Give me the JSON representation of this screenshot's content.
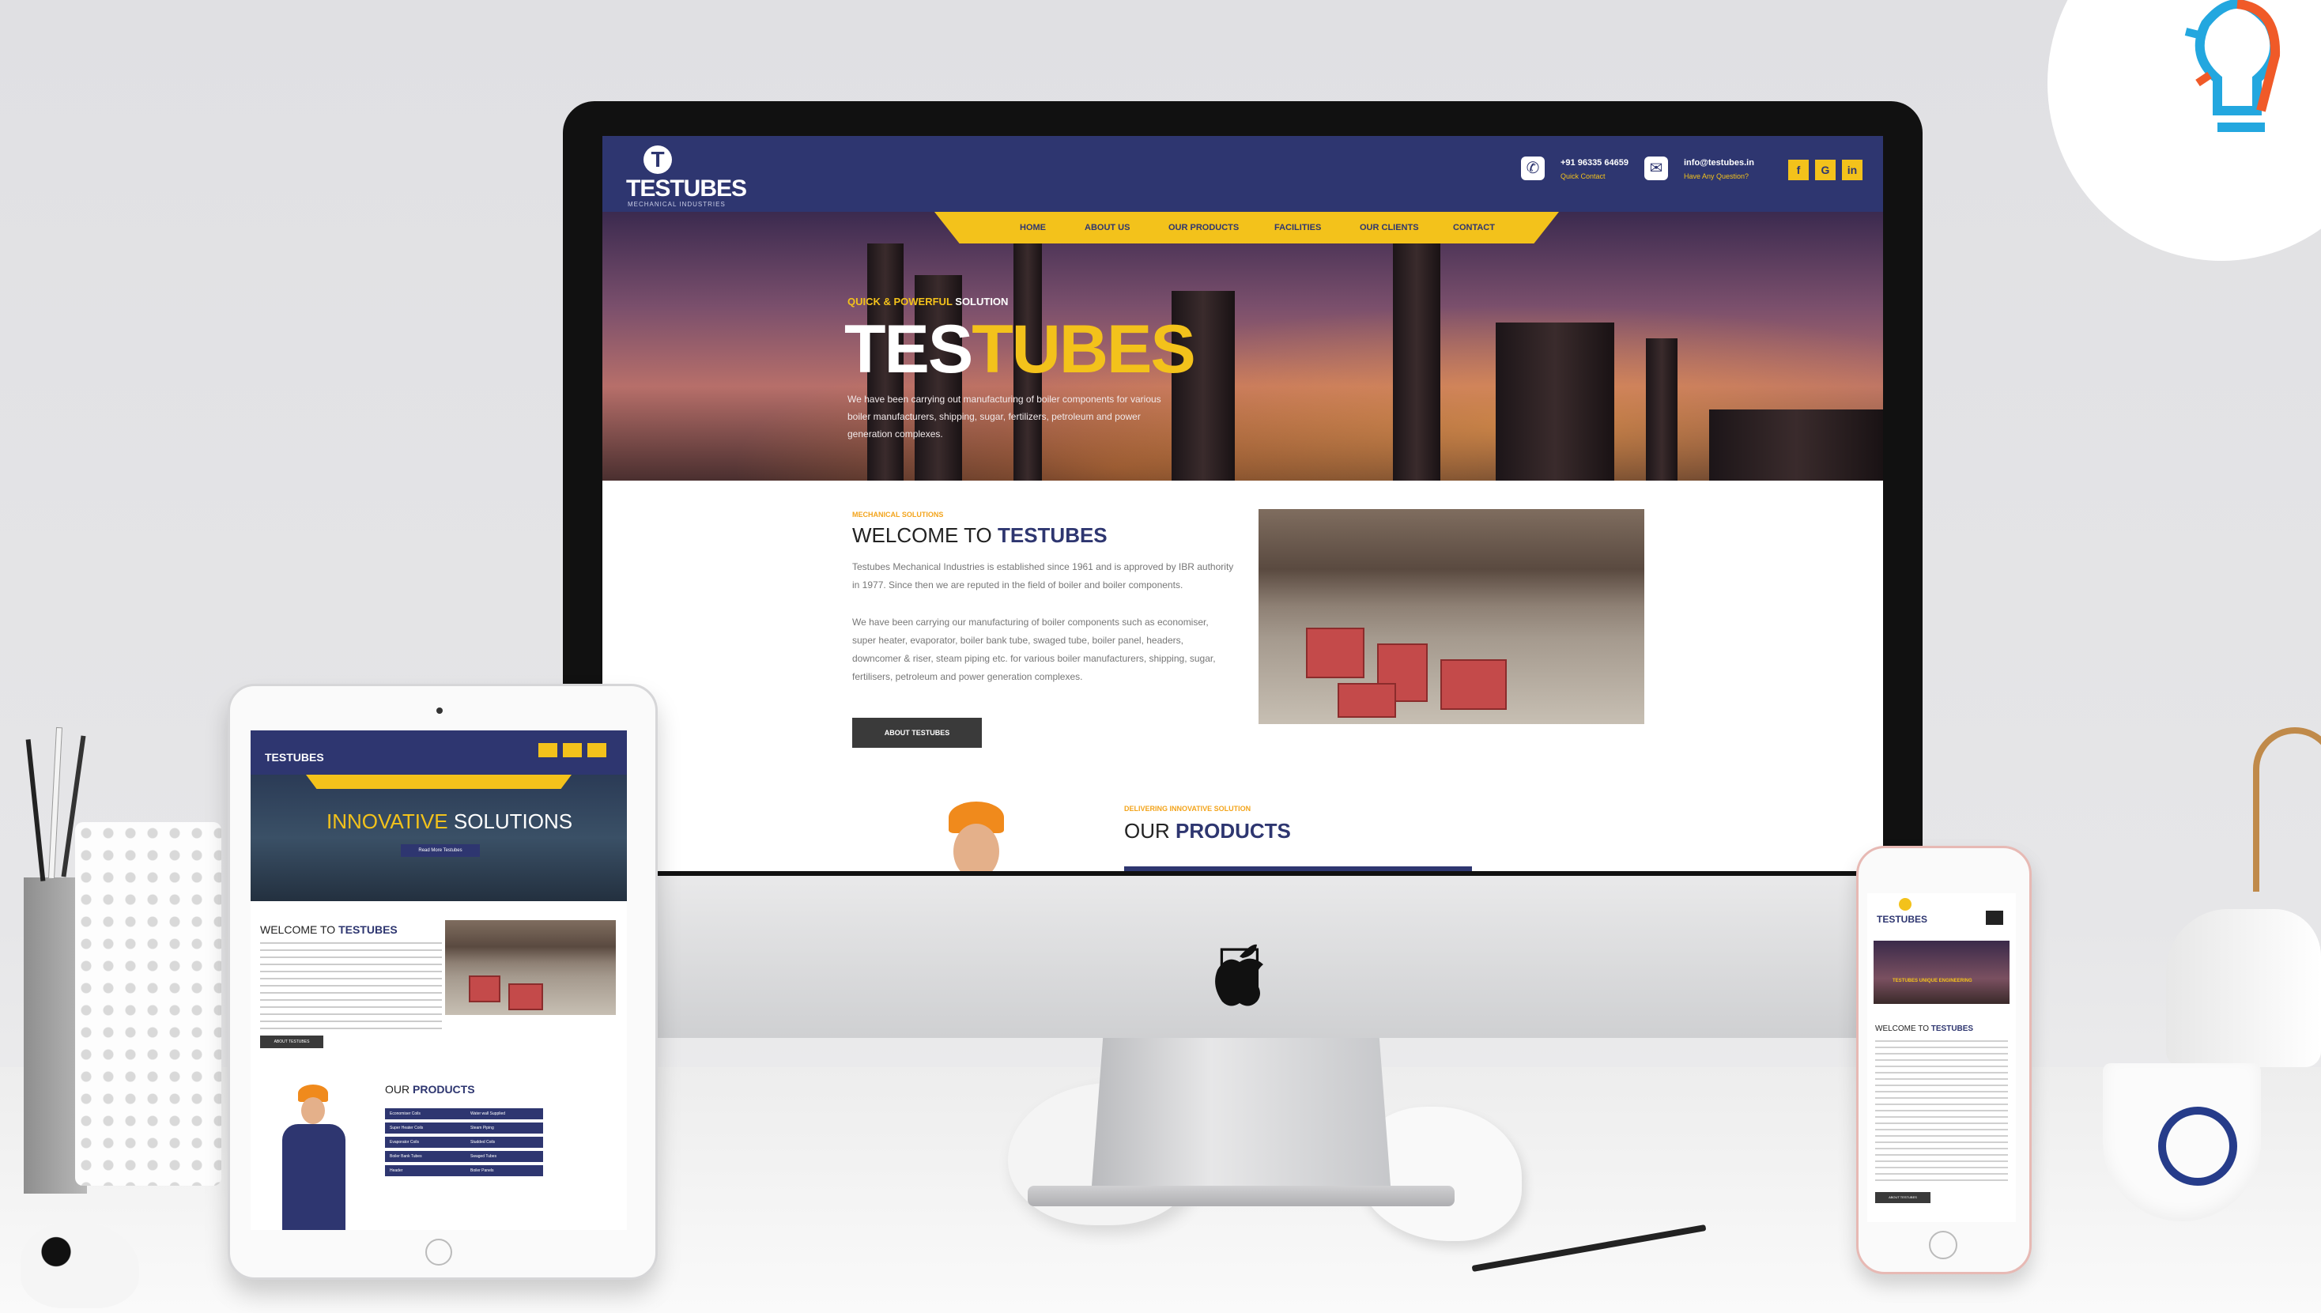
{
  "desktop": {
    "logo": "TESTUBES",
    "logo_sub": "MECHANICAL INDUSTRIES",
    "phone": "+91 96335 64659",
    "phone_sub": "Quick Contact",
    "email": "info@testubes.in",
    "email_sub": "Have Any Question?",
    "social": [
      "f",
      "G",
      "in"
    ],
    "nav": [
      "HOME",
      "ABOUT US",
      "OUR PRODUCTS",
      "FACILITIES",
      "OUR CLIENTS",
      "CONTACT"
    ],
    "hero": {
      "kicker_a": "QUICK & POWERFUL",
      "kicker_b": " SOLUTION",
      "title_a": "TES",
      "title_b": "TUBES",
      "text": "We have been carrying out manufacturing of boiler components for various boiler manufacturers, shipping, sugar, fertilizers, petroleum and power generation complexes."
    },
    "welcome": {
      "kicker": "MECHANICAL SOLUTIONS",
      "title_a": "WELCOME TO ",
      "title_b": "TESTUBES",
      "p1": "Testubes Mechanical Industries is established since 1961 and is approved by IBR authority in 1977. Since then we are reputed in the field of boiler and boiler components.",
      "p2": "We have been carrying our manufacturing of boiler components such as economiser, super heater, evaporator, boiler bank tube, swaged tube, boiler panel, headers, downcomer & riser, steam piping etc. for various boiler manufacturers, shipping, sugar, fertilisers, petroleum and power generation complexes.",
      "button": "ABOUT TESTUBES"
    },
    "products": {
      "kicker": "DELIVERING INNOVATIVE SOLUTION",
      "title_a": "OUR ",
      "title_b": "PRODUCTS"
    }
  },
  "tablet": {
    "logo": "TESTUBES",
    "hero_a": "INNOVATIVE",
    "hero_b": " SOLUTIONS",
    "hero_btn": "Read More Testubes",
    "welcome_a": "WELCOME TO ",
    "welcome_b": "TESTUBES",
    "btn": "ABOUT TESTUBES",
    "products_a": "OUR ",
    "products_b": "PRODUCTS",
    "product_items": [
      "Economiser Coils",
      "Water wall Supplied",
      "Super Heater Coils",
      "Steam Piping",
      "Evaporator Coils",
      "Studded Coils",
      "Boiler Bank Tubes",
      "Swaged Tubes",
      "Header",
      "Boiler Panels"
    ]
  },
  "phone": {
    "logo": "TESTUBES",
    "hero": "TESTUBES UNIQUE ENGINEERING",
    "welcome_a": "WELCOME TO ",
    "welcome_b": "TESTUBES",
    "btn": "ABOUT TESTUBES"
  },
  "colors": {
    "navy": "#2e3670",
    "yellow": "#f3c21b"
  }
}
